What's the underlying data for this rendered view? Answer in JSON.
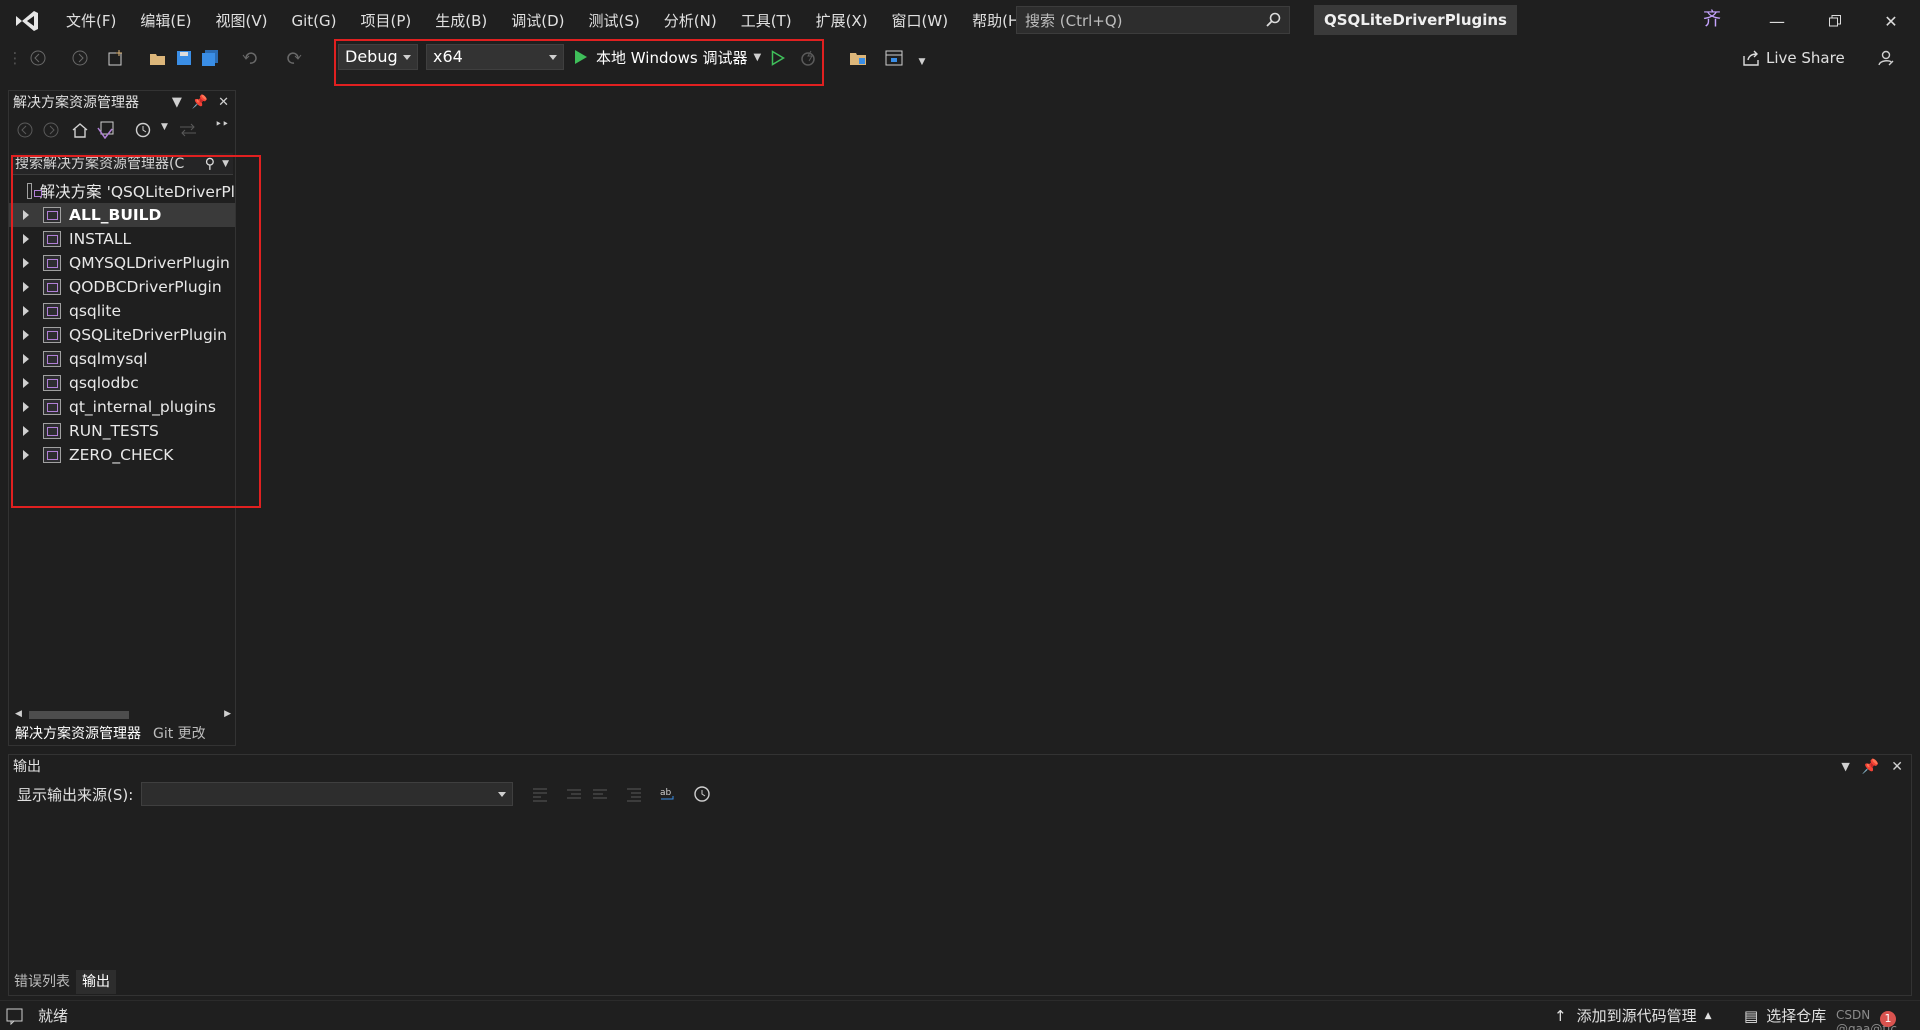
{
  "menu": {
    "items": [
      "文件(F)",
      "编辑(E)",
      "视图(V)",
      "Git(G)",
      "项目(P)",
      "生成(B)",
      "调试(D)",
      "测试(S)",
      "分析(N)",
      "工具(T)",
      "扩展(X)",
      "窗口(W)",
      "帮助(H)"
    ]
  },
  "search": {
    "placeholder": "搜索 (Ctrl+Q)"
  },
  "window": {
    "project_title": "QSQLiteDriverPlugins",
    "user_initial": "齐"
  },
  "toolbar": {
    "configuration": "Debug",
    "platform": "x64",
    "debugger_label": "本地 Windows 调试器",
    "live_share": "Live Share"
  },
  "solution_explorer": {
    "title": "解决方案资源管理器",
    "search_placeholder": "搜索解决方案资源管理器(C",
    "solution_label": "解决方案 'QSQLiteDriverPl",
    "projects": [
      {
        "label": "ALL_BUILD",
        "selected": true
      },
      {
        "label": "INSTALL"
      },
      {
        "label": "QMYSQLDriverPlugin"
      },
      {
        "label": "QODBCDriverPlugin"
      },
      {
        "label": "qsqlite"
      },
      {
        "label": "QSQLiteDriverPlugin"
      },
      {
        "label": "qsqlmysql"
      },
      {
        "label": "qsqlodbc"
      },
      {
        "label": "qt_internal_plugins"
      },
      {
        "label": "RUN_TESTS"
      },
      {
        "label": "ZERO_CHECK"
      }
    ],
    "tabs": [
      "解决方案资源管理器",
      "Git 更改"
    ]
  },
  "output": {
    "title": "输出",
    "source_label": "显示输出来源(S):",
    "tabs": [
      "错误列表",
      "输出"
    ]
  },
  "statusbar": {
    "ready": "就绪",
    "add_to_source_control": "添加到源代码管理",
    "select_repo": "选择仓库",
    "notification_count": "1",
    "watermark": "CSDN @qaa@tic"
  },
  "colors": {
    "accent_highlight": "#e02020",
    "play_green": "#3fbf5a",
    "vs_purple": "#b180d7"
  }
}
